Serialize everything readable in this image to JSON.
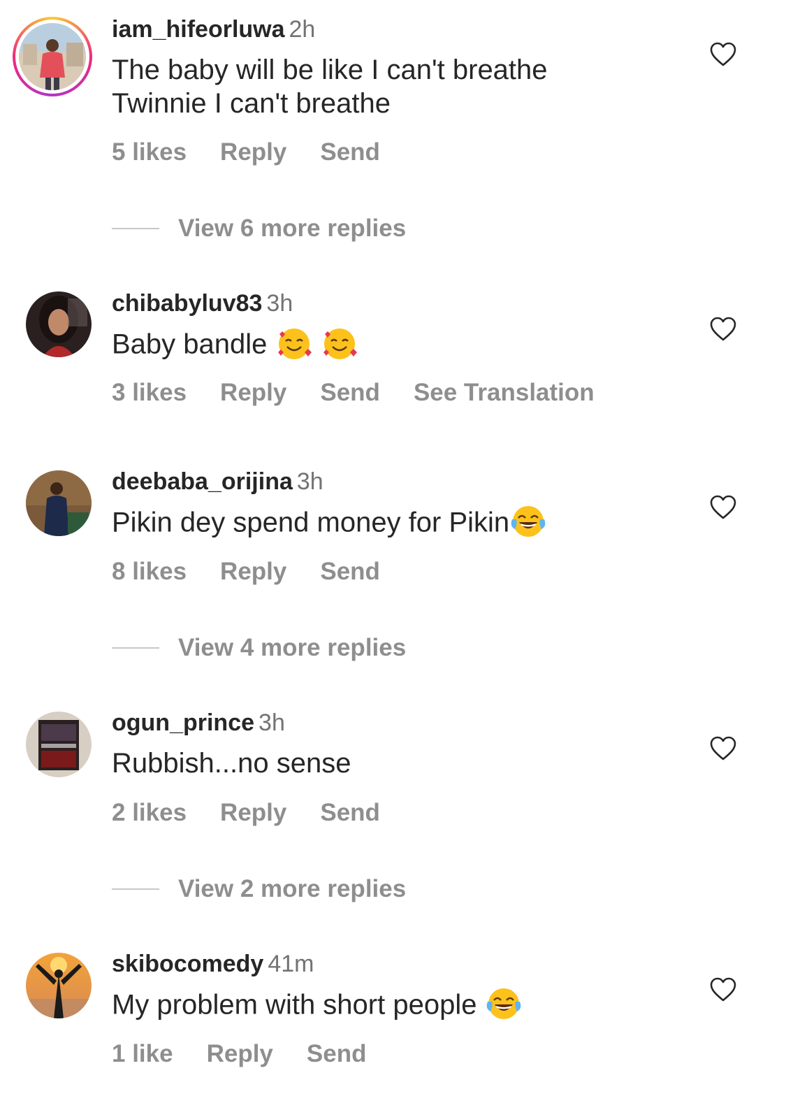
{
  "comments": [
    {
      "username": "iam_hifeorluwa",
      "time": "2h",
      "text_lines": [
        "The baby will be like I can't breathe",
        "Twinnie I can't breathe"
      ],
      "likes": "5 likes",
      "reply": "Reply",
      "send": "Send",
      "has_story_ring": true
    },
    {
      "username": "chibabyluv83",
      "time": "3h",
      "text": "Baby bandle ",
      "emoji_names": [
        "smiling-face-with-hearts",
        "smiling-face-with-hearts"
      ],
      "likes": "3 likes",
      "reply": "Reply",
      "send": "Send",
      "translate": "See Translation"
    },
    {
      "username": "deebaba_orijina",
      "time": "3h",
      "text": "Pikin dey spend money for Pikin",
      "emoji_names": [
        "face-with-tears-of-joy"
      ],
      "likes": "8 likes",
      "reply": "Reply",
      "send": "Send"
    },
    {
      "username": "ogun_prince",
      "time": "3h",
      "text": "Rubbish...no sense",
      "likes": "2 likes",
      "reply": "Reply",
      "send": "Send"
    },
    {
      "username": "skibocomedy",
      "time": "41m",
      "text": "My problem with short people ",
      "emoji_names": [
        "face-with-tears-of-joy"
      ],
      "likes": "1 like",
      "reply": "Reply",
      "send": "Send"
    }
  ],
  "view_replies": [
    "View 6 more replies",
    "View 4 more replies",
    "View 2 more replies"
  ],
  "colors": {
    "text": "#262626",
    "secondary": "#8e8e8e",
    "divider": "#c7c7c7"
  }
}
